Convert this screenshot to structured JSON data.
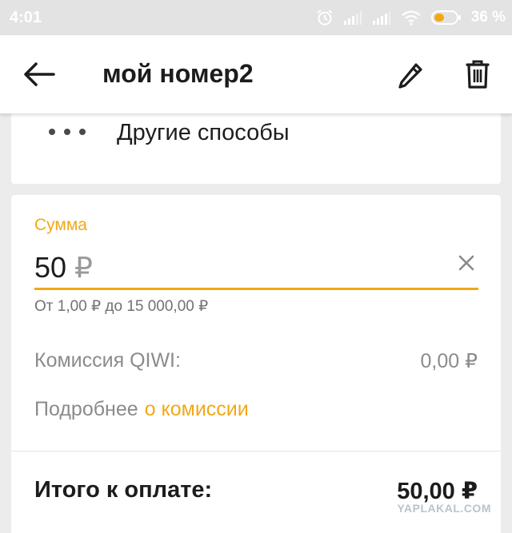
{
  "status_bar": {
    "time": "4:01",
    "battery_percent": "36 %",
    "icons": [
      "alarm-icon",
      "signal-icon",
      "signal-icon",
      "wifi-icon",
      "battery-icon"
    ]
  },
  "app_bar": {
    "title": "мой номер2",
    "icons": [
      "back-arrow-icon",
      "pencil-icon",
      "trash-icon"
    ]
  },
  "other_methods": {
    "label": "Другие способы",
    "icon": "more-dots-icon"
  },
  "payment": {
    "sum_label": "Сумма",
    "amount": "50",
    "currency": "₽",
    "range_hint": "От 1,00 ₽ до 15 000,00 ₽",
    "commission_label": "Комиссия QIWI:",
    "commission_value": "0,00 ₽",
    "more_prefix": "Подробнее",
    "more_link": "о комиссии",
    "total_label": "Итого к оплате:",
    "total_value": "50,00 ₽"
  },
  "watermark": "YAPLAKAL.COM",
  "colors": {
    "accent": "#f2a816",
    "text_primary": "#1c1c1c",
    "text_secondary": "#8b8b8b",
    "background": "#ececec",
    "card": "#ffffff"
  }
}
